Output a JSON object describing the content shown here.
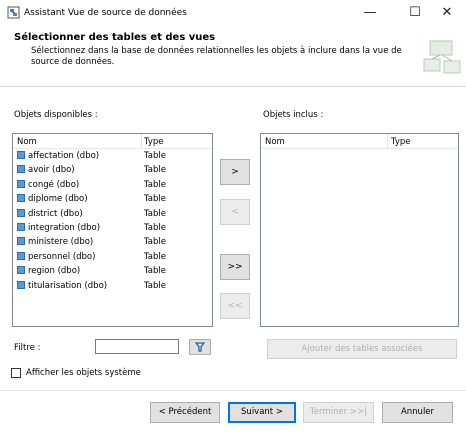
{
  "window": {
    "title": "Assistant Vue de source de données",
    "minimize_glyph": "—",
    "maximize_glyph": "☐",
    "close_glyph": "✕"
  },
  "header": {
    "title": "Sélectionner des tables et des vues",
    "description": "Sélectionnez dans la base de données relationnelles les objets à inclure dans la vue de source de données."
  },
  "available": {
    "label": "Objets disponibles :",
    "col_name": "Nom",
    "col_type": "Type",
    "rows": [
      {
        "name": "affectation (dbo)",
        "type": "Table"
      },
      {
        "name": "avoir (dbo)",
        "type": "Table"
      },
      {
        "name": "congé (dbo)",
        "type": "Table"
      },
      {
        "name": "diplome (dbo)",
        "type": "Table"
      },
      {
        "name": "district (dbo)",
        "type": "Table"
      },
      {
        "name": "integration (dbo)",
        "type": "Table"
      },
      {
        "name": "ministere (dbo)",
        "type": "Table"
      },
      {
        "name": "personnel (dbo)",
        "type": "Table"
      },
      {
        "name": "region (dbo)",
        "type": "Table"
      },
      {
        "name": "titularisation (dbo)",
        "type": "Table"
      }
    ]
  },
  "included": {
    "label": "Objets inclus :",
    "col_name": "Nom",
    "col_type": "Type"
  },
  "transfer": {
    "add_one": ">",
    "remove_one": "<",
    "add_all": ">>",
    "remove_all": "<<"
  },
  "filter": {
    "label": "Filtre :",
    "value": ""
  },
  "add_related_label": "Ajouter des tables associées",
  "show_system_label": "Afficher les objets système",
  "footer": {
    "back": "< Précédent",
    "next": "Suivant >",
    "finish": "Terminer >>|",
    "cancel": "Annuler"
  }
}
